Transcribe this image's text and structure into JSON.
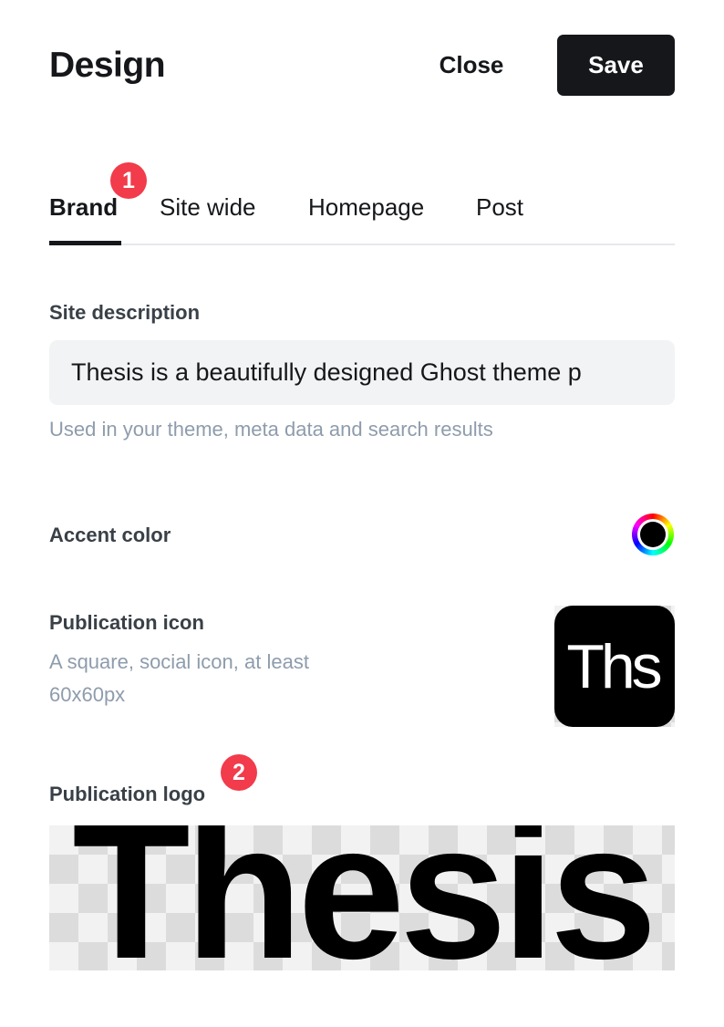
{
  "header": {
    "title": "Design",
    "close_label": "Close",
    "save_label": "Save"
  },
  "tabs": [
    {
      "label": "Brand",
      "active": true
    },
    {
      "label": "Site wide",
      "active": false
    },
    {
      "label": "Homepage",
      "active": false
    },
    {
      "label": "Post",
      "active": false
    }
  ],
  "badges": {
    "first": "1",
    "second": "2"
  },
  "site_description": {
    "label": "Site description",
    "value": "Thesis is a beautifully designed Ghost theme p",
    "hint": "Used in your theme, meta data and search results"
  },
  "accent_color": {
    "label": "Accent color",
    "value": "#000000"
  },
  "publication_icon": {
    "label": "Publication icon",
    "hint": "A square, social icon, at least 60x60px",
    "image_text": "Ths"
  },
  "publication_logo": {
    "label": "Publication logo",
    "image_text": "Thesis"
  },
  "colors": {
    "primary": "#15171a",
    "badge": "#f23b4b",
    "input_bg": "#f1f3f4",
    "hint_text": "#8e9cac"
  }
}
